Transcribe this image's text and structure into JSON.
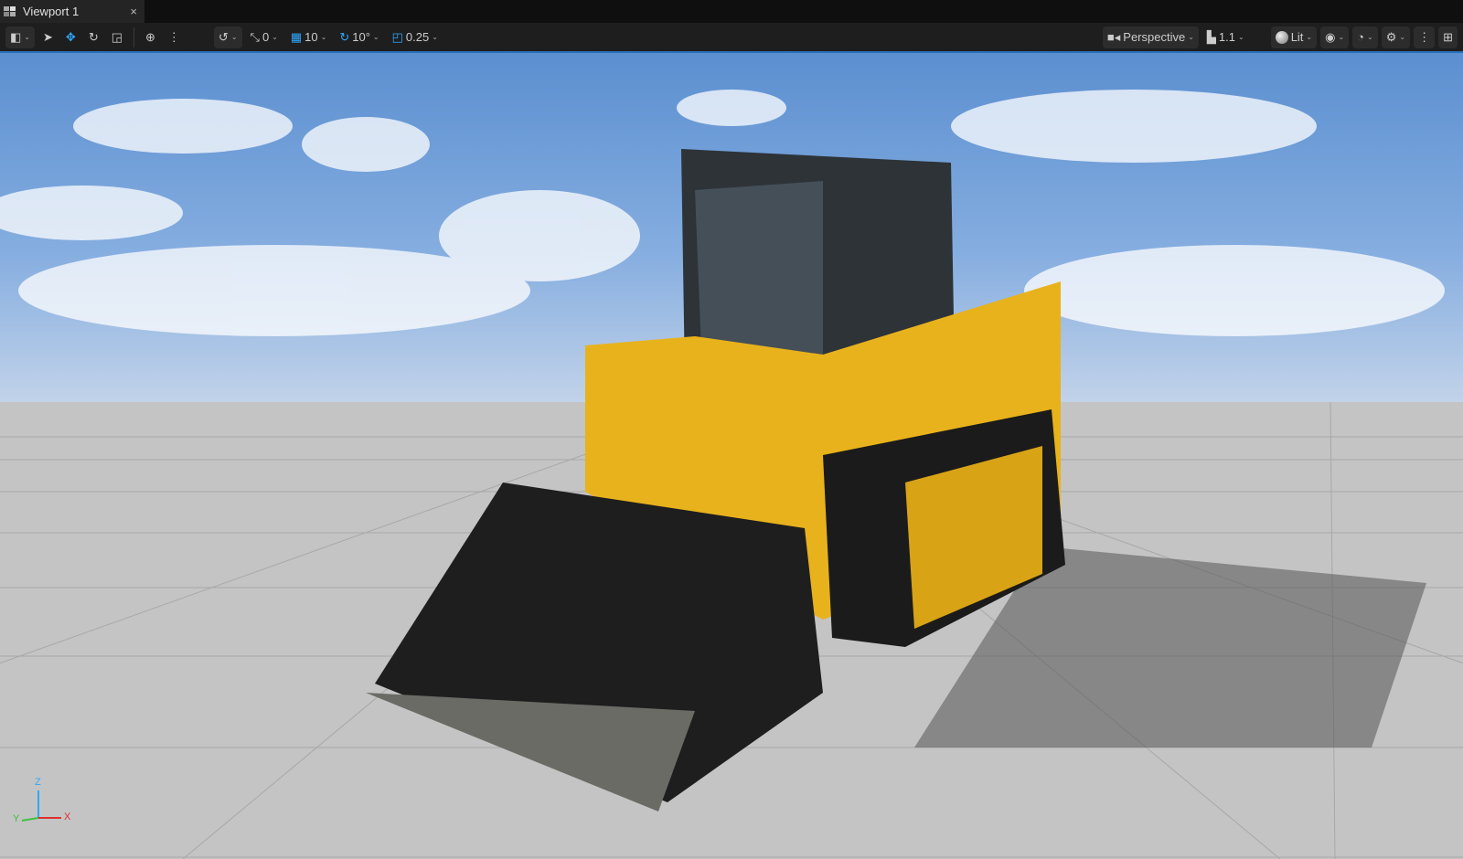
{
  "tab": {
    "title": "Viewport 1",
    "close": "×"
  },
  "toolbar": {
    "translate_snap": "0",
    "grid_snap": "10",
    "rotate_snap": "10°",
    "scale_snap": "0.25",
    "view_mode": "Perspective",
    "camera_speed": "1.1",
    "lit_mode": "Lit"
  },
  "gizmo": {
    "z": "Z",
    "x": "X",
    "y": "Y"
  },
  "colors": {
    "accent": "#2ea8ff",
    "machine": "#e8b21c"
  }
}
